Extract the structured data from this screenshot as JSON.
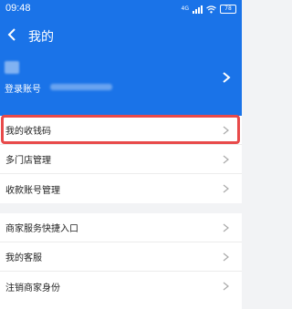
{
  "status_bar": {
    "time": "09:48",
    "network": "4G",
    "battery": "78"
  },
  "header": {
    "title": "我的",
    "account_label": "登录账号"
  },
  "menu": {
    "group1": [
      {
        "label": "我的收钱码",
        "highlighted": true
      },
      {
        "label": "多门店管理"
      },
      {
        "label": "收款账号管理"
      }
    ],
    "group2": [
      {
        "label": "商家服务快捷入口"
      },
      {
        "label": "我的客服"
      },
      {
        "label": "注销商家身份"
      }
    ]
  },
  "colors": {
    "header_bg": "#1a73e8",
    "highlight": "#e84a4a",
    "page_bg": "#f2f3f5"
  }
}
